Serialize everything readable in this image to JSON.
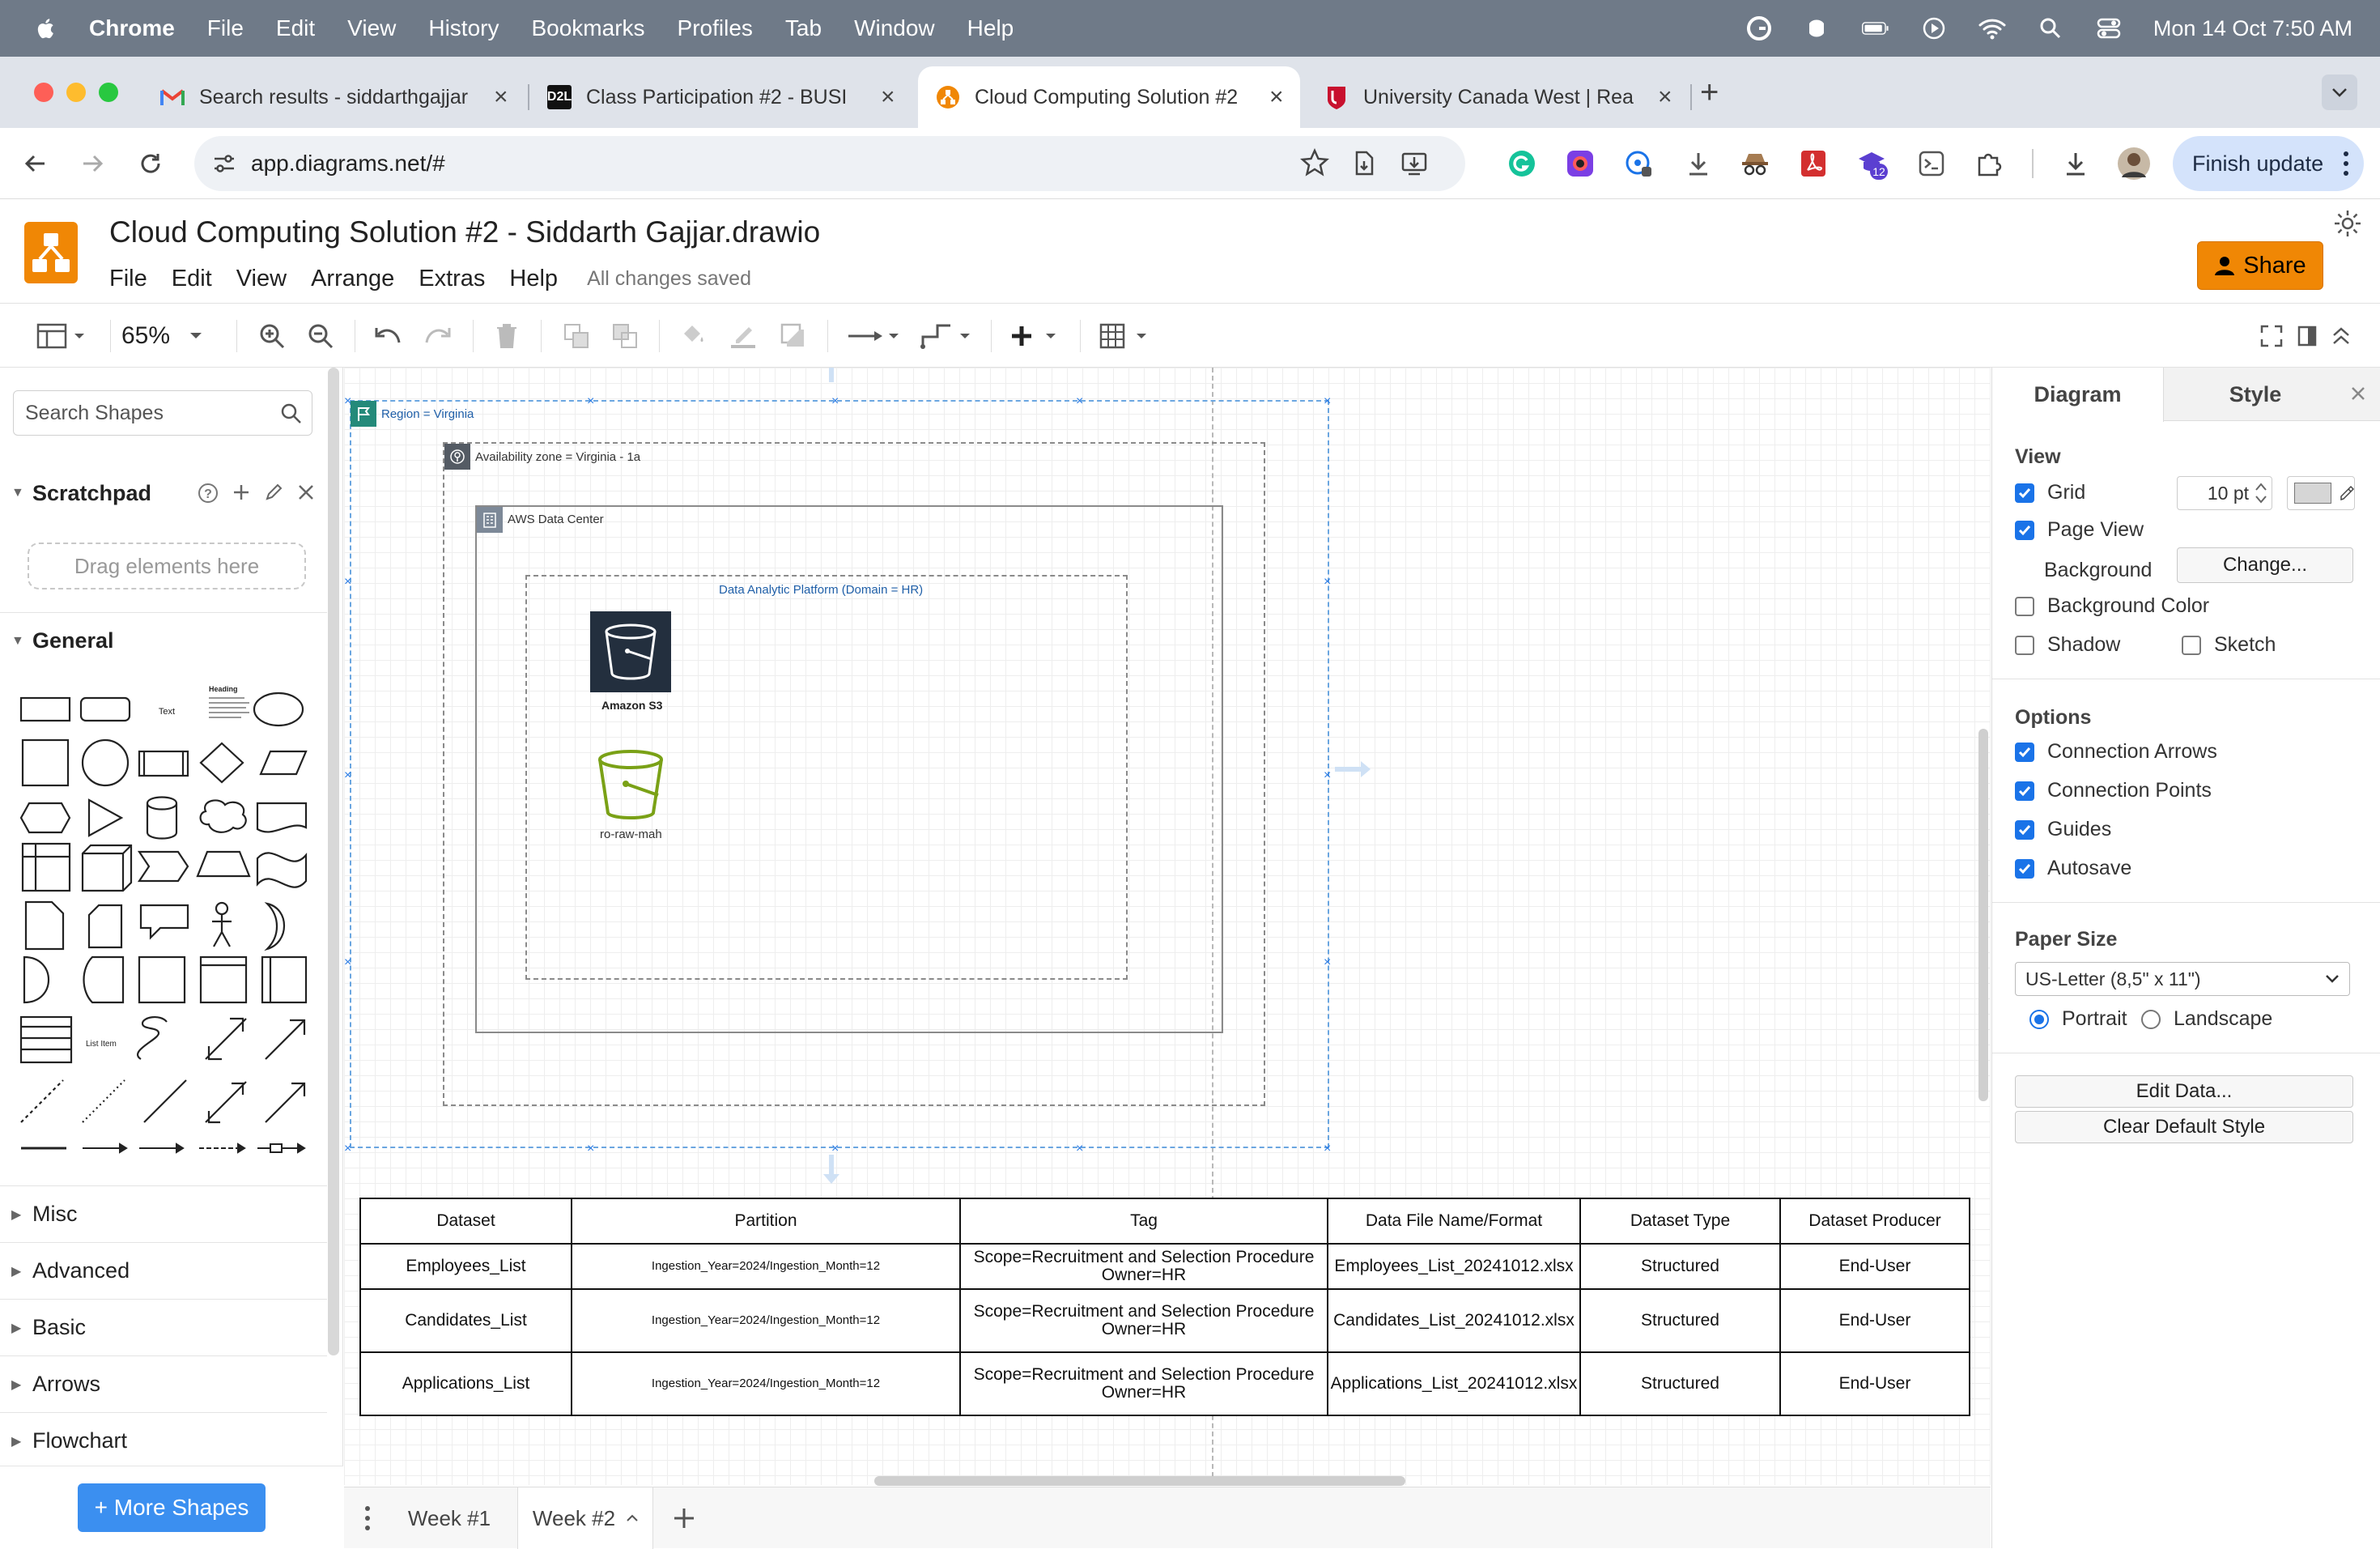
{
  "menubar": {
    "app": "Chrome",
    "items": [
      "File",
      "Edit",
      "View",
      "History",
      "Bookmarks",
      "Profiles",
      "Tab",
      "Window",
      "Help"
    ],
    "clock": "Mon 14 Oct  7:50 AM"
  },
  "tabs": [
    {
      "title": "Search results - siddarthgajjar",
      "icon": "gmail-icon"
    },
    {
      "title": "Class Participation #2 - BUSI",
      "icon": "d2l-icon",
      "icon_text": "D2L"
    },
    {
      "title": "Cloud Computing Solution #2",
      "icon": "drawio-icon"
    },
    {
      "title": "University Canada West | Rea",
      "icon": "ucw-icon"
    }
  ],
  "browser": {
    "url": "app.diagrams.net/#",
    "finish_update": "Finish update",
    "extension_badge": "12"
  },
  "drawio": {
    "title": "Cloud Computing Solution #2 - Siddarth Gajjar.drawio",
    "menu": [
      "File",
      "Edit",
      "View",
      "Arrange",
      "Extras",
      "Help"
    ],
    "saved_status": "All changes saved",
    "share": "Share",
    "zoom": "65%"
  },
  "sidebar": {
    "search_placeholder": "Search Shapes",
    "scratchpad": "Scratchpad",
    "drag_here": "Drag elements here",
    "general": "General",
    "shape_text": "Text",
    "shape_heading": "Heading",
    "shape_list_item": "List Item",
    "sections": [
      "Misc",
      "Advanced",
      "Basic",
      "Arrows",
      "Flowchart"
    ],
    "more_shapes": "+ More Shapes"
  },
  "diagram": {
    "region": "Region = Virginia",
    "az": "Availability zone = Virginia - 1a",
    "datacenter": "AWS Data Center",
    "platform": "Data Analytic Platform (Domain = HR)",
    "s3_label": "Amazon S3",
    "bucket_label": "ro-raw-mah"
  },
  "table": {
    "headers": [
      "Dataset",
      "Partition",
      "Tag",
      "Data File Name/Format",
      "Dataset Type",
      "Dataset Producer"
    ],
    "rows": [
      [
        "Employees_List",
        "Ingestion_Year=2024/Ingestion_Month=12",
        "Scope=Recruitment and Selection Procedure\nOwner=HR",
        "Employees_List_20241012.xlsx",
        "Structured",
        "End-User"
      ],
      [
        "Candidates_List",
        "Ingestion_Year=2024/Ingestion_Month=12",
        "Scope=Recruitment and Selection Procedure\nOwner=HR",
        "Candidates_List_20241012.xlsx",
        "Structured",
        "End-User"
      ],
      [
        "Applications_List",
        "Ingestion_Year=2024/Ingestion_Month=12",
        "Scope=Recruitment and Selection Procedure\nOwner=HR",
        "Applications_List_20241012.xlsx",
        "Structured",
        "End-User"
      ]
    ]
  },
  "pages": [
    "Week #1",
    "Week #2"
  ],
  "format_panel": {
    "tabs": [
      "Diagram",
      "Style"
    ],
    "view": "View",
    "grid": "Grid",
    "grid_size": "10 pt",
    "page_view": "Page View",
    "background": "Background",
    "change": "Change...",
    "background_color": "Background Color",
    "shadow": "Shadow",
    "sketch": "Sketch",
    "options": "Options",
    "connection_arrows": "Connection Arrows",
    "connection_points": "Connection Points",
    "guides": "Guides",
    "autosave": "Autosave",
    "paper_size": "Paper Size",
    "paper_value": "US-Letter (8,5\" x 11\")",
    "portrait": "Portrait",
    "landscape": "Landscape",
    "edit_data": "Edit Data...",
    "clear_style": "Clear Default Style"
  },
  "colors": {
    "drawio_orange": "#f08705",
    "accent_blue": "#1a73e8",
    "s3_dark": "#232f3e",
    "bucket_green": "#7aa116"
  }
}
